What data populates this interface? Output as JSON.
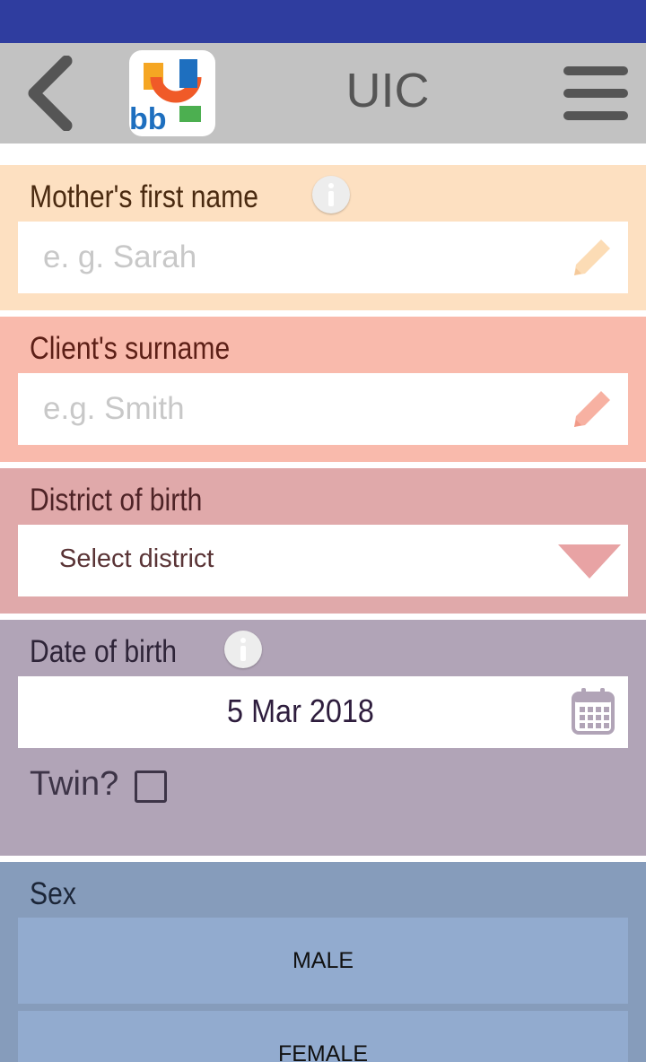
{
  "app_bar": {
    "title": "UIC",
    "logo_text": "bb"
  },
  "icons": {
    "back": "back-arrow-icon",
    "menu": "hamburger-menu-icon",
    "info": "info-icon",
    "edit": "pencil-icon",
    "dropdown": "triangle-down-icon",
    "calendar": "calendar-icon"
  },
  "colors": {
    "status_bar": "#2f3d9f",
    "app_bar": "#c2c2c2",
    "mother_section": "#fde0c1",
    "surname_section": "#f9baac",
    "district_section": "#e0a9aa",
    "dob_section": "#b1a4b7",
    "sex_section": "#869cbb"
  },
  "form": {
    "mother_first_name": {
      "label": "Mother's first name",
      "value": "",
      "placeholder": "e. g. Sarah"
    },
    "client_surname": {
      "label": "Client's surname",
      "value": "",
      "placeholder": "e.g. Smith"
    },
    "district_of_birth": {
      "label": "District of birth",
      "selected": "Select district"
    },
    "date_of_birth": {
      "label": "Date of birth",
      "value": "5 Mar 2018"
    },
    "twin": {
      "label": "Twin?",
      "checked": false
    },
    "sex": {
      "label": "Sex",
      "options": [
        "MALE",
        "FEMALE"
      ]
    }
  }
}
